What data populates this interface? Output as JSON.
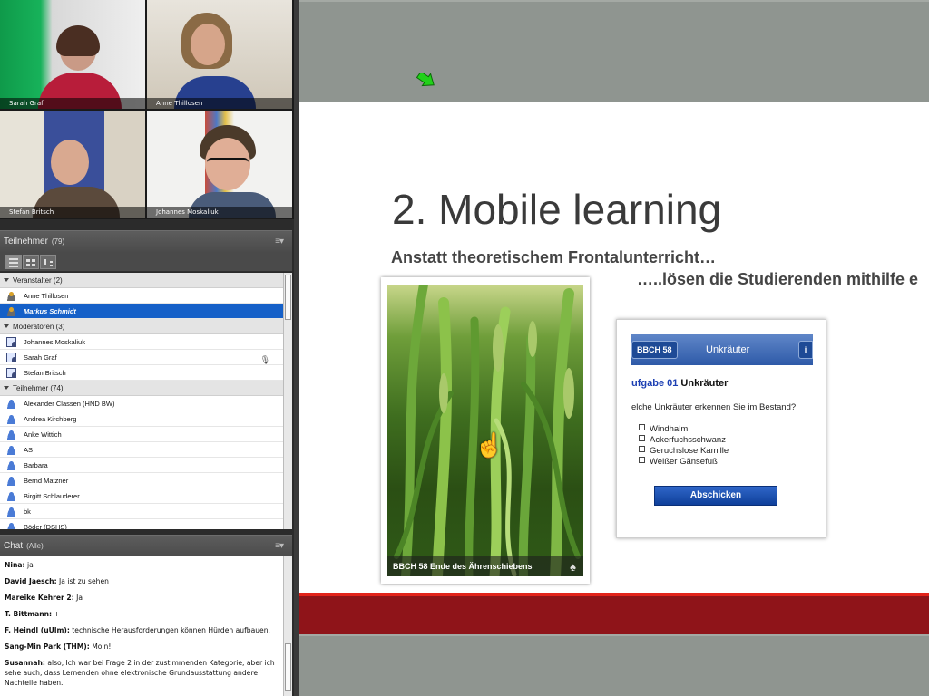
{
  "videos": [
    {
      "name": "Sarah Graf"
    },
    {
      "name": "Anne Thillosen"
    },
    {
      "name": "Stefan Britsch"
    },
    {
      "name": "Johannes Moskaliuk"
    }
  ],
  "attendees": {
    "title": "Teilnehmer",
    "count": "(79)",
    "groups": [
      {
        "label": "Veranstalter (2)",
        "members": [
          {
            "name": "Anne Thillosen",
            "icon": "host-icon"
          },
          {
            "name": "Markus Schmidt",
            "icon": "host-icon",
            "selected": true
          }
        ]
      },
      {
        "label": "Moderatoren (3)",
        "members": [
          {
            "name": "Johannes Moskaliuk",
            "icon": "presenter-icon"
          },
          {
            "name": "Sarah Graf",
            "icon": "presenter-icon",
            "mic": true
          },
          {
            "name": "Stefan Britsch",
            "icon": "presenter-icon"
          }
        ]
      },
      {
        "label": "Teilnehmer (74)",
        "members": [
          {
            "name": "Alexander Classen (HND BW)",
            "icon": "user-icon"
          },
          {
            "name": "Andrea Kirchberg",
            "icon": "user-icon"
          },
          {
            "name": "Anke Wittich",
            "icon": "user-icon"
          },
          {
            "name": "AS",
            "icon": "user-icon"
          },
          {
            "name": "Barbara",
            "icon": "user-icon"
          },
          {
            "name": "Bernd Matzner",
            "icon": "user-icon"
          },
          {
            "name": "Birgitt Schlauderer",
            "icon": "user-icon"
          },
          {
            "name": "bk",
            "icon": "user-icon"
          },
          {
            "name": "Böder (DSHS)",
            "icon": "user-icon"
          }
        ]
      }
    ]
  },
  "chat": {
    "title": "Chat",
    "scope": "(Alle)",
    "messages": [
      {
        "sender": "Nina:",
        "text": "ja"
      },
      {
        "sender": "David Jaesch:",
        "text": "Ja ist zu sehen"
      },
      {
        "sender": "Mareike Kehrer 2:",
        "text": "Ja"
      },
      {
        "sender": "T. Bittmann:",
        "text": "+"
      },
      {
        "sender": "F. Heindl (uUlm):",
        "text": "technische Herausforderungen können Hürden aufbauen."
      },
      {
        "sender": "Sang-Min Park (THM):",
        "text": "Moin!"
      },
      {
        "sender": "Susannah:",
        "text": "also, Ich war bei Frage 2 in der zustimmenden Kategorie, aber ich sehe auch, dass Lernenden ohne elektronische Grundausstattung andere Nachteile haben."
      }
    ]
  },
  "slide": {
    "title": "2. Mobile learning",
    "subtitle": "Anstatt theoretischem Frontalunterricht…",
    "subtitle2": "…..lösen die Studierenden mithilfe e",
    "photo_caption": "BBCH 58  Ende des Ährenschiebens",
    "app": {
      "back_label": "BBCH 58",
      "bar_title": "Unkräuter",
      "info_label": "i",
      "task_prefix": "ufgabe 01",
      "task_name": "Unkräuter",
      "question": "elche Unkräuter erkennen Sie im Bestand?",
      "options": [
        "Windhalm",
        "Ackerfuchsschwanz",
        "Geruchslose Kamille",
        "Weißer Gänsefuß"
      ],
      "submit_label": "Abschicken"
    }
  },
  "colors": {
    "accent_red": "#e2231a",
    "dark_red": "#8f1419",
    "selection_blue": "#1560c8",
    "button_blue": "#0f3f9a"
  }
}
